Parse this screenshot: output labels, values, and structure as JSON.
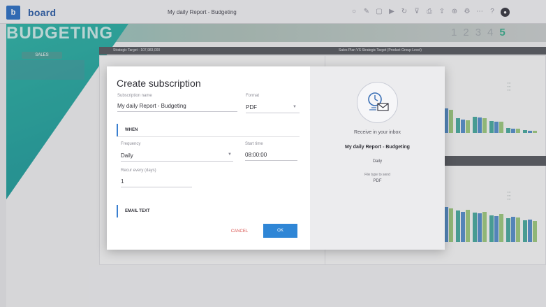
{
  "app": {
    "logo_letter": "b",
    "logo_word": "board",
    "title": "My daily Report - Budgeting"
  },
  "toolbar_icons": [
    "circle-icon",
    "edit-icon",
    "copy-icon",
    "play-icon",
    "refresh-icon",
    "filter-icon",
    "print-icon",
    "export-icon",
    "zoom-icon",
    "settings-icon",
    "more-icon",
    "help-icon",
    "user-icon"
  ],
  "dashboard": {
    "heading": "BUDGETING",
    "pages": [
      "1",
      "2",
      "3",
      "4",
      "5"
    ],
    "active_page": "5",
    "sales_pill": "SALES",
    "panel_top_left": "Strategic Target - 107,983,000",
    "panel_top_right": "Sales Plan VS Strategic Target (Product Group Level)"
  },
  "modal": {
    "title": "Create subscription",
    "subscription_name_label": "Subscription name",
    "subscription_name_value": "My daily Report - Budgeting",
    "format_label": "Format",
    "format_value": "PDF",
    "section_when": "WHEN",
    "frequency_label": "Frequency",
    "frequency_value": "Daily",
    "start_time_label": "Start time",
    "start_time_value": "08:00:00",
    "recur_label": "Recur every (days)",
    "recur_value": "1",
    "section_email": "EMAIL TEXT",
    "cancel_label": "CANCEL",
    "ok_label": "OK"
  },
  "preview": {
    "receive_label": "Receive in your inbox",
    "report_name": "My daily Report - Budgeting",
    "frequency": "Daily",
    "file_type_label": "File type to send",
    "file_type": "PDF"
  },
  "colors": {
    "accent": "#2f86d6",
    "cancel": "#d9534f",
    "teal": "#2fb6a8",
    "bar_teal": "#2a9d8f",
    "bar_blue": "#3a7ec4",
    "bar_green": "#8ec36a"
  }
}
